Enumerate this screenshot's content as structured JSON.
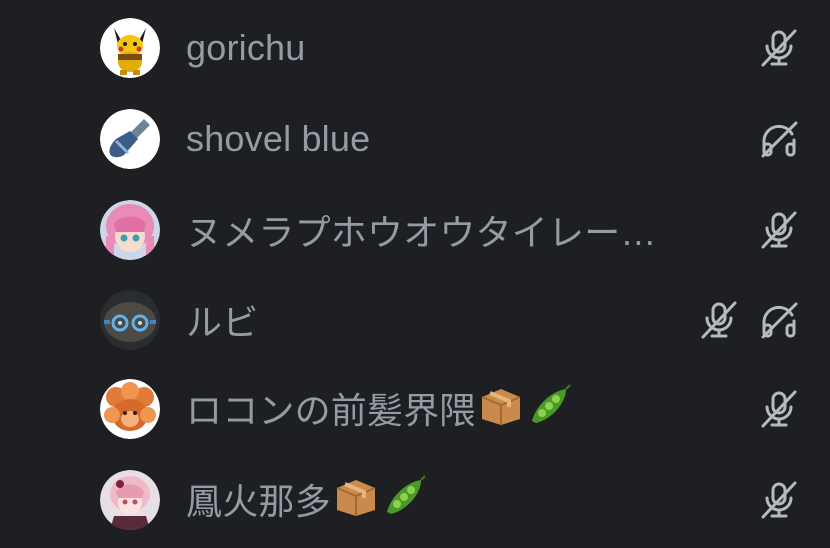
{
  "members": [
    {
      "name": "gorichu",
      "avatar_icon": "pikachu-avatar",
      "status_icons": [
        "mic-muted-icon"
      ]
    },
    {
      "name": "shovel blue",
      "avatar_icon": "shovel-avatar",
      "status_icons": [
        "headphones-deafened-icon"
      ]
    },
    {
      "name": "ヌメラプホウオウタイレー…",
      "avatar_icon": "anime-girl-pink-avatar",
      "status_icons": [
        "mic-muted-icon"
      ]
    },
    {
      "name": "ルビ",
      "avatar_icon": "dark-robot-avatar",
      "status_icons": [
        "mic-muted-icon",
        "headphones-deafened-icon"
      ]
    },
    {
      "name": "ロコンの前髪界隈",
      "avatar_icon": "vulpix-avatar",
      "status_icons": [
        "mic-muted-icon"
      ],
      "emojis": [
        "package-emoji",
        "peas-emoji"
      ]
    },
    {
      "name": "鳳火那多",
      "avatar_icon": "anime-girl-rose-avatar",
      "status_icons": [
        "mic-muted-icon"
      ],
      "emojis": [
        "package-emoji",
        "peas-emoji"
      ]
    }
  ],
  "colors": {
    "background": "#1e1f22",
    "name_text": "#949ba4",
    "icon": "#b5bac1"
  }
}
